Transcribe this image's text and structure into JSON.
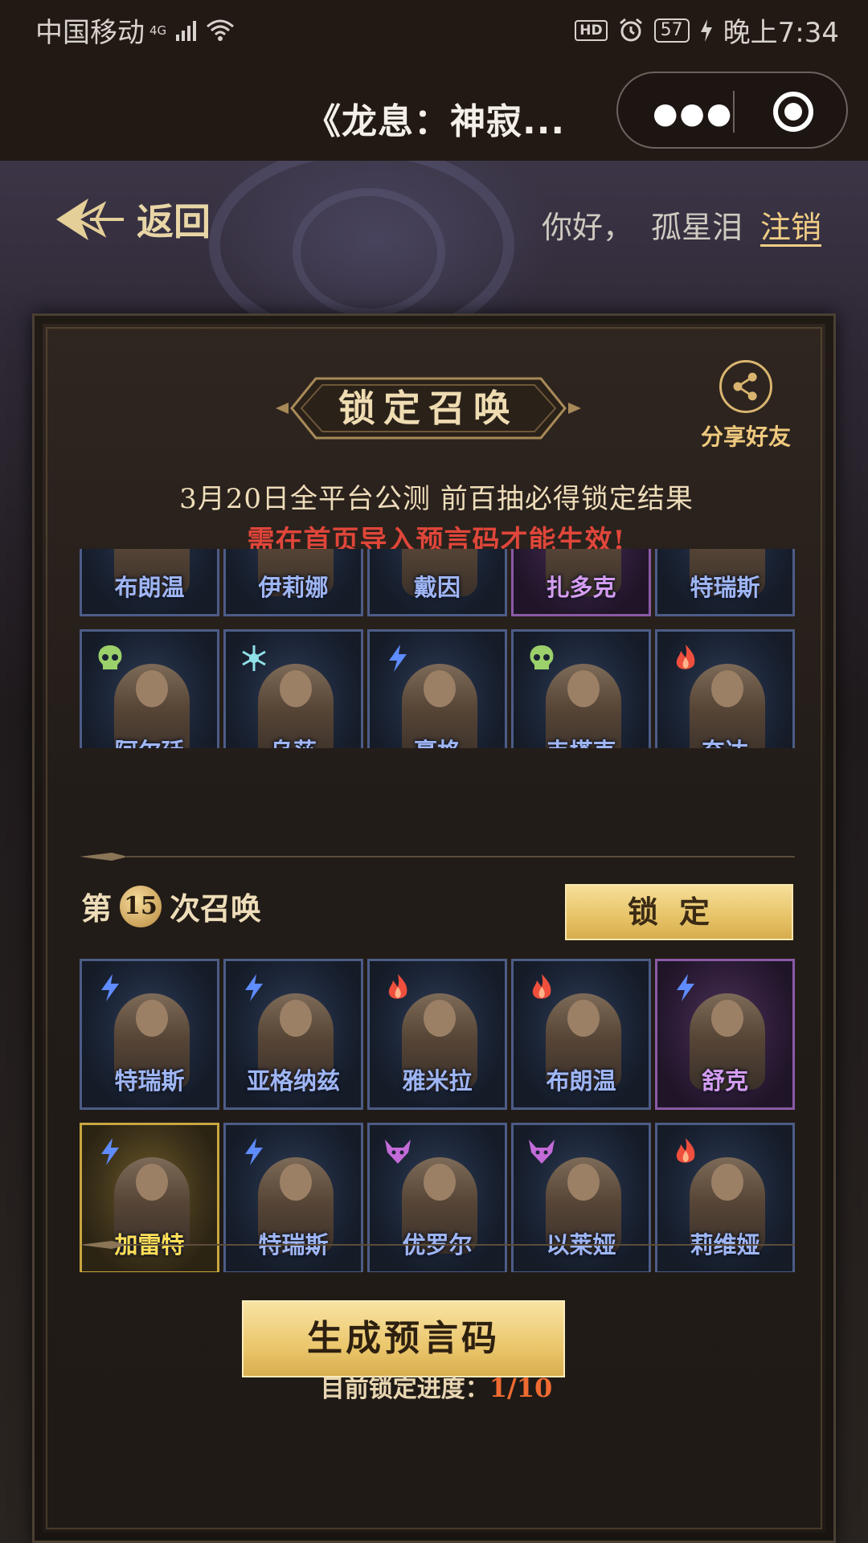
{
  "status_bar": {
    "carrier": "中国移动",
    "network": "4G",
    "hd": "HD",
    "battery": "57",
    "time": "晚上7:34"
  },
  "title_bar": {
    "title": "《龙息：神寂...",
    "more_icon": "more-dots-icon",
    "close_icon": "target-circle-icon"
  },
  "header": {
    "back_label": "返回",
    "greeting": "你好，",
    "username": "孤星泪",
    "logout": "注销"
  },
  "panel": {
    "banner_title": "锁定召唤",
    "share_label": "分享好友",
    "info_line1": "3月20日全平台公测 前百抽必得锁定结果",
    "info_line2": "需在首页导入预言码才能生效!",
    "prev_round": {
      "rows": [
        [
          {
            "name": "布朗温",
            "rarity": "blue",
            "element": "fire-icon"
          },
          {
            "name": "伊莉娜",
            "rarity": "blue",
            "element": "ice-icon"
          },
          {
            "name": "戴因",
            "rarity": "blue",
            "element": "fire-icon"
          },
          {
            "name": "扎多克",
            "rarity": "purple",
            "element": "lightning-icon"
          },
          {
            "name": "特瑞斯",
            "rarity": "blue",
            "element": "lightning-icon"
          }
        ],
        [
          {
            "name": "阿尔廷",
            "rarity": "blue",
            "element": "skull-icon"
          },
          {
            "name": "乌莎",
            "rarity": "blue",
            "element": "ice-icon"
          },
          {
            "name": "豪格",
            "rarity": "blue",
            "element": "lightning-icon"
          },
          {
            "name": "韦塔克",
            "rarity": "blue",
            "element": "skull-icon"
          },
          {
            "name": "奈达",
            "rarity": "blue",
            "element": "fire-icon"
          }
        ]
      ]
    },
    "round": {
      "prefix": "第",
      "number": "15",
      "suffix": "次召唤",
      "lock_label": "锁定",
      "rows": [
        [
          {
            "name": "特瑞斯",
            "rarity": "blue",
            "element": "lightning-icon"
          },
          {
            "name": "亚格纳兹",
            "rarity": "blue",
            "element": "lightning-icon"
          },
          {
            "name": "雅米拉",
            "rarity": "blue",
            "element": "fire-icon"
          },
          {
            "name": "布朗温",
            "rarity": "blue",
            "element": "fire-icon"
          },
          {
            "name": "舒克",
            "rarity": "purple",
            "element": "lightning-icon"
          }
        ],
        [
          {
            "name": "加雷特",
            "rarity": "gold",
            "element": "lightning-icon"
          },
          {
            "name": "特瑞斯",
            "rarity": "blue",
            "element": "lightning-icon"
          },
          {
            "name": "优罗尔",
            "rarity": "blue",
            "element": "demon-icon"
          },
          {
            "name": "以莱娅",
            "rarity": "blue",
            "element": "demon-icon"
          },
          {
            "name": "莉维娅",
            "rarity": "blue",
            "element": "fire-icon"
          }
        ]
      ]
    },
    "generate_label": "生成预言码",
    "progress_label": "目前锁定进度：",
    "progress_value": "1/10"
  },
  "colors": {
    "gold_accent": "#efc97e",
    "warning_red": "#e0463a",
    "progress_orange": "#ef6b32",
    "blue_rarity": "#4d5c86",
    "purple_rarity": "#8a5aa6",
    "gold_rarity": "#c8a640"
  }
}
